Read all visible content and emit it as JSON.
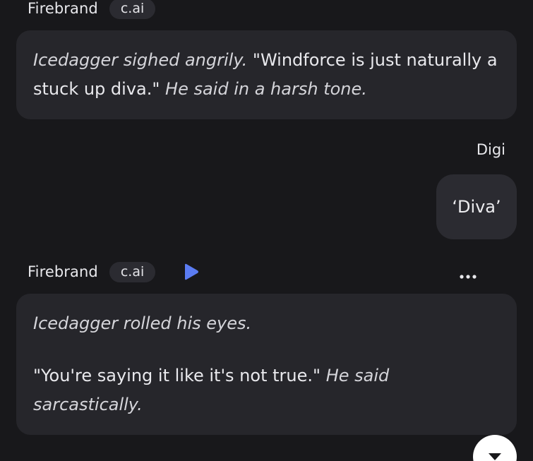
{
  "messages": [
    {
      "sender": "Firebrand",
      "tag": "c.ai",
      "segments": [
        {
          "text": "Icedagger sighed angrily.",
          "italic": true
        },
        {
          "text": " \"Windforce is just naturally a stuck up diva.\" ",
          "italic": false
        },
        {
          "text": "He said in a harsh tone.",
          "italic": true
        }
      ]
    },
    {
      "sender": "Digi",
      "text": "‘Diva’"
    },
    {
      "sender": "Firebrand",
      "tag": "c.ai",
      "line1": "Icedagger rolled his eyes.",
      "line2_quote": "\"You're saying it like it's not true.\"",
      "line2_italic": "He said sarcastically."
    }
  ],
  "icons": {
    "play": "play-icon",
    "more": "more-options-icon",
    "scroll": "chevron-down-icon"
  },
  "colors": {
    "background": "#18181b",
    "bubble": "#26262b",
    "tag": "#2b2b31",
    "play_accent": "#5b7cf2"
  }
}
